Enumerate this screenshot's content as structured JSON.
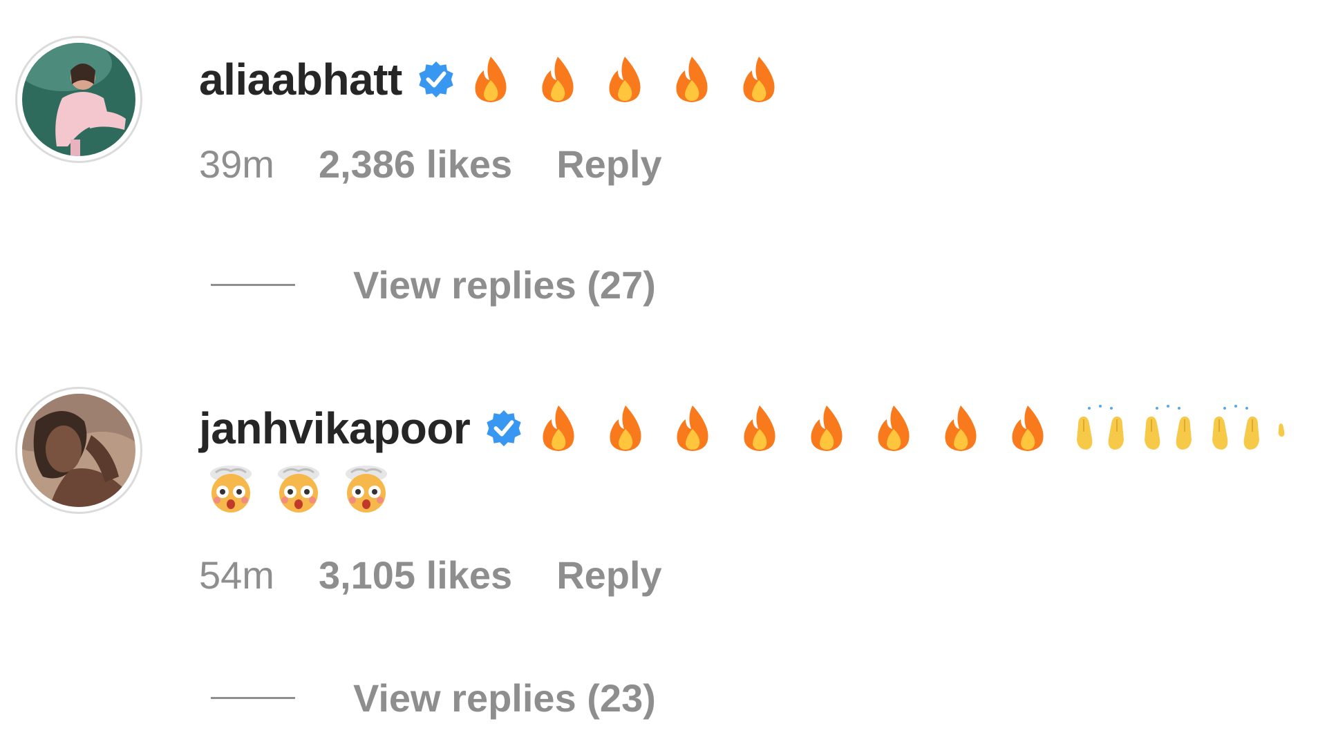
{
  "comments": [
    {
      "username": "aliaabhatt",
      "verified": true,
      "emojis": [
        "fire",
        "fire",
        "fire",
        "fire",
        "fire"
      ],
      "emojis_line2": [],
      "time": "39m",
      "likes": "2,386 likes",
      "reply_label": "Reply",
      "view_replies": "View replies (27)",
      "avatar_colors": {
        "bg": "#2f6b5d",
        "figure": "#f4c7cf"
      }
    },
    {
      "username": "janhvikapoor",
      "verified": true,
      "emojis": [
        "fire",
        "fire",
        "fire",
        "fire",
        "fire",
        "fire",
        "fire",
        "fire",
        "raising-hands",
        "raising-hands",
        "raising-hands",
        "raising-hands"
      ],
      "emojis_line2": [
        "exploding-head",
        "exploding-head",
        "exploding-head"
      ],
      "time": "54m",
      "likes": "3,105 likes",
      "reply_label": "Reply",
      "view_replies": "View replies (23)",
      "avatar_colors": {
        "bg": "#b89a85",
        "figure": "#5a3b2e"
      }
    }
  ],
  "colors": {
    "verified": "#3897f0",
    "fire_outer": "#f97a1d",
    "fire_inner": "#ffc53d",
    "muted_text": "#8e8e8e",
    "primary_text": "#262626"
  }
}
